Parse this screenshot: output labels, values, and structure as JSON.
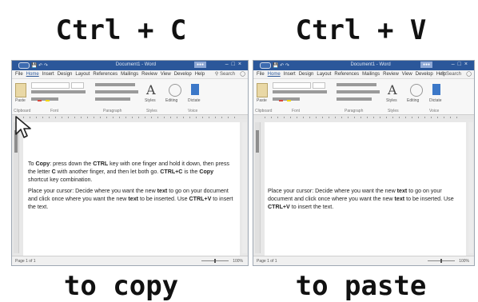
{
  "captions": {
    "left_top": "Ctrl + C",
    "right_top": "Ctrl + V",
    "left_bottom": "to copy",
    "right_bottom": "to paste"
  },
  "word_window": {
    "title": "Document1 - Word",
    "menu_tabs": [
      "File",
      "Home",
      "Insert",
      "Design",
      "Layout",
      "References",
      "Mailings",
      "Review",
      "View",
      "Develop",
      "Help"
    ],
    "active_tab": "Home",
    "tell_me": "Search",
    "share": "Share",
    "ribbon_groups": [
      "Clipboard",
      "Font",
      "Paragraph",
      "Styles",
      "Editing",
      "Voice"
    ],
    "ribbon_labels": {
      "paste": "Paste",
      "styles": "Styles",
      "editing": "Editing",
      "dictate": "Dictate"
    },
    "status": "Page 1 of 1",
    "zoom": "100%",
    "accent_color": "#2b579a"
  },
  "left_doc": {
    "para1": {
      "t1": "To ",
      "b1": "Copy",
      "t2": ": press down the ",
      "b2": "CTRL",
      "t3": " key with one finger and hold it down, then press the letter ",
      "b3": "C",
      "t4": " with another finger, and then let both go. ",
      "b4": "CTRL+C",
      "t5": " is the ",
      "b5": "Copy",
      "t6": " shortcut key combination."
    },
    "para2": {
      "t1": "Place your cursor: Decide where you want the new ",
      "b1": "text",
      "t2": " to go on your document and click once where you want the new ",
      "b2": "text",
      "t3": " to be inserted. Use ",
      "b3": "CTRL+V",
      "t4": " to insert the text."
    }
  },
  "right_doc": {
    "para2": {
      "t1": "Place your cursor: Decide where you want the new ",
      "b1": "text",
      "t2": " to go on your document and click once where you want the new ",
      "b2": "text",
      "t3": " to be inserted. Use ",
      "b3": "CTRL+V",
      "t4": " to insert the text."
    }
  }
}
